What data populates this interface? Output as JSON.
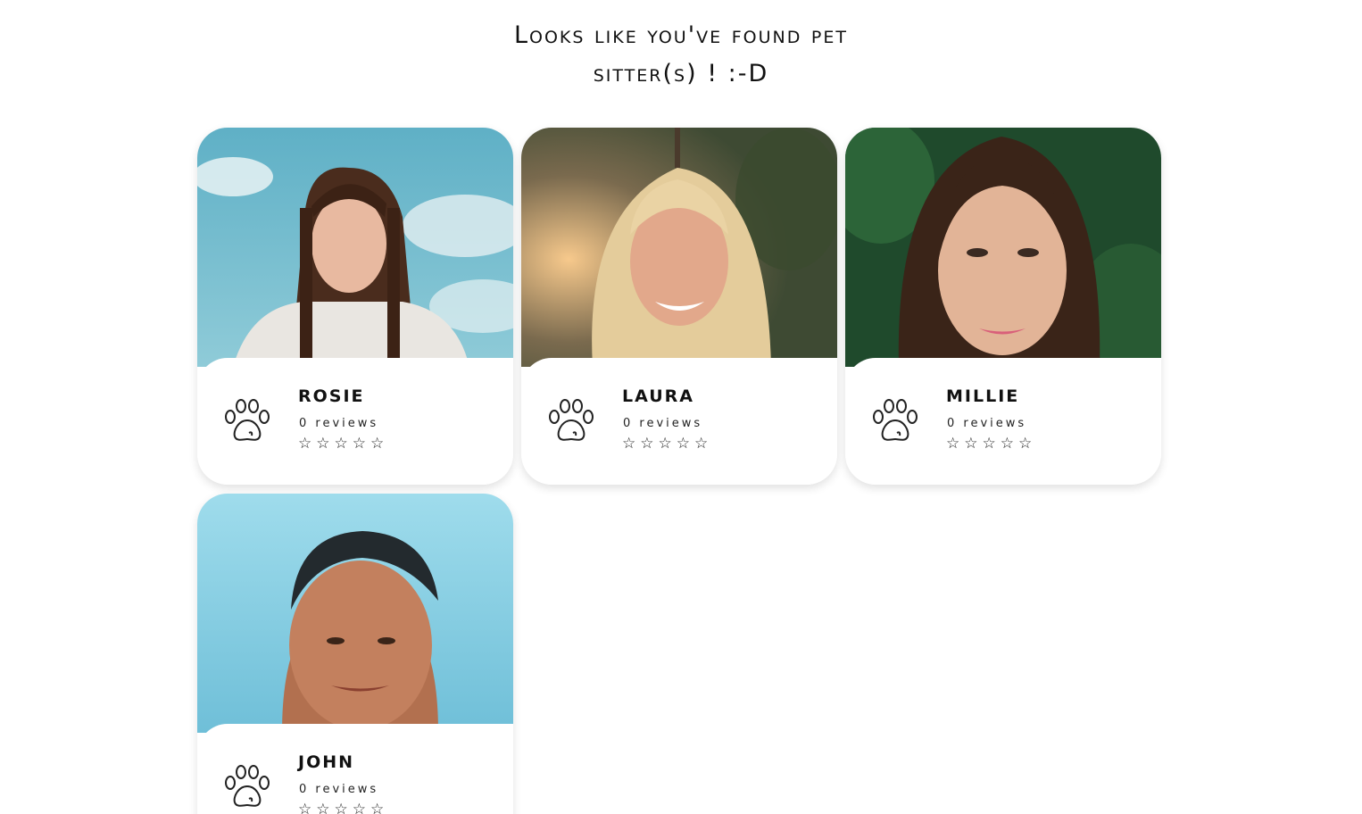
{
  "page": {
    "title_line1": "Looks like you've found pet",
    "title_line2": "sitter(s) ! :-D"
  },
  "sitters": [
    {
      "name": "ROSIE",
      "reviews_label": "0 reviews",
      "stars": "☆☆☆☆☆",
      "rating": 0,
      "icon": "paw-icon"
    },
    {
      "name": "LAURA",
      "reviews_label": "0 reviews",
      "stars": "☆☆☆☆☆",
      "rating": 0,
      "icon": "paw-icon"
    },
    {
      "name": "MILLIE",
      "reviews_label": "0 reviews",
      "stars": "☆☆☆☆☆",
      "rating": 0,
      "icon": "paw-icon"
    },
    {
      "name": "JOHN",
      "reviews_label": "0 reviews",
      "stars": "☆☆☆☆☆",
      "rating": 0,
      "icon": "paw-icon"
    }
  ],
  "colors": {
    "background": "#ffffff",
    "text": "#111111",
    "card_shadow": "rgba(0,0,0,0.12)"
  }
}
